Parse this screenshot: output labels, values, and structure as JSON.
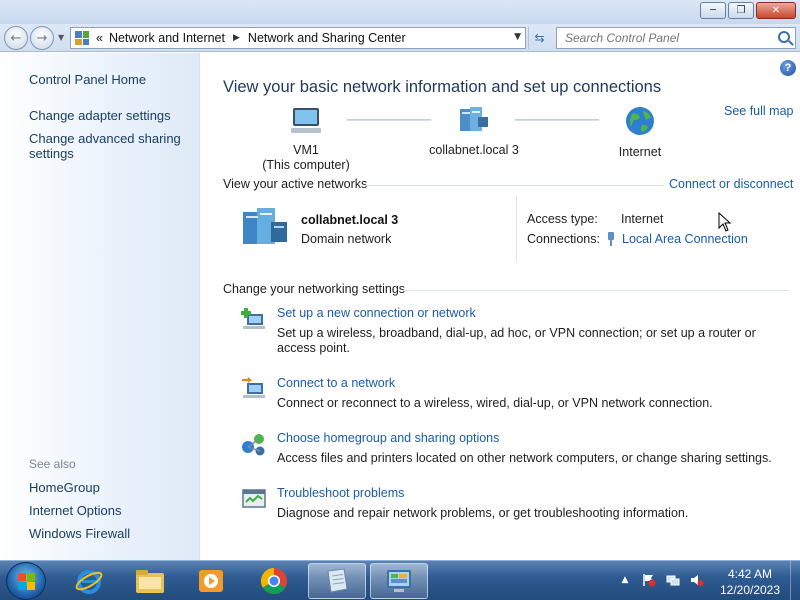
{
  "addressbar": {
    "chevron": "«",
    "crumbs": [
      "Network and Internet",
      "Network and Sharing Center"
    ],
    "search_placeholder": "Search Control Panel"
  },
  "sidebar": {
    "items": [
      {
        "label": "Control Panel Home"
      },
      {
        "label": "Change adapter settings"
      },
      {
        "label": "Change advanced sharing settings"
      }
    ],
    "see_also_title": "See also",
    "see_also": [
      {
        "label": "HomeGroup"
      },
      {
        "label": "Internet Options"
      },
      {
        "label": "Windows Firewall"
      }
    ]
  },
  "main": {
    "title": "View your basic network information and set up connections",
    "see_full_map": "See full map",
    "map": {
      "computer_name": "VM1",
      "computer_sub": "(This computer)",
      "network_name": "collabnet.local  3",
      "internet": "Internet"
    },
    "active_networks": {
      "heading": "View your active networks",
      "connect_link": "Connect or disconnect",
      "name": "collabnet.local  3",
      "type": "Domain network",
      "access_label": "Access type:",
      "access_value": "Internet",
      "connections_label": "Connections:",
      "connections_value": "Local Area Connection"
    },
    "settings": {
      "heading": "Change your networking settings",
      "tasks": [
        {
          "title": "Set up a new connection or network",
          "desc": "Set up a wireless, broadband, dial-up, ad hoc, or VPN connection; or set up a router or access point.",
          "icon": "new-connection-icon"
        },
        {
          "title": "Connect to a network",
          "desc": "Connect or reconnect to a wireless, wired, dial-up, or VPN network connection.",
          "icon": "connect-network-icon"
        },
        {
          "title": "Choose homegroup and sharing options",
          "desc": "Access files and printers located on other network computers, or change sharing settings.",
          "icon": "homegroup-icon"
        },
        {
          "title": "Troubleshoot problems",
          "desc": "Diagnose and repair network problems, or get troubleshooting information.",
          "icon": "troubleshoot-icon"
        }
      ]
    }
  },
  "taskbar": {
    "time": "4:42 AM",
    "date": "12/20/2023",
    "apps": [
      "internet-explorer-icon",
      "windows-explorer-icon",
      "media-player-icon",
      "chrome-icon",
      "notepad-icon",
      "control-panel-icon"
    ]
  },
  "colors": {
    "link": "#1a5ca8",
    "title": "#1e395b",
    "taskbar": "#2f5c93"
  }
}
